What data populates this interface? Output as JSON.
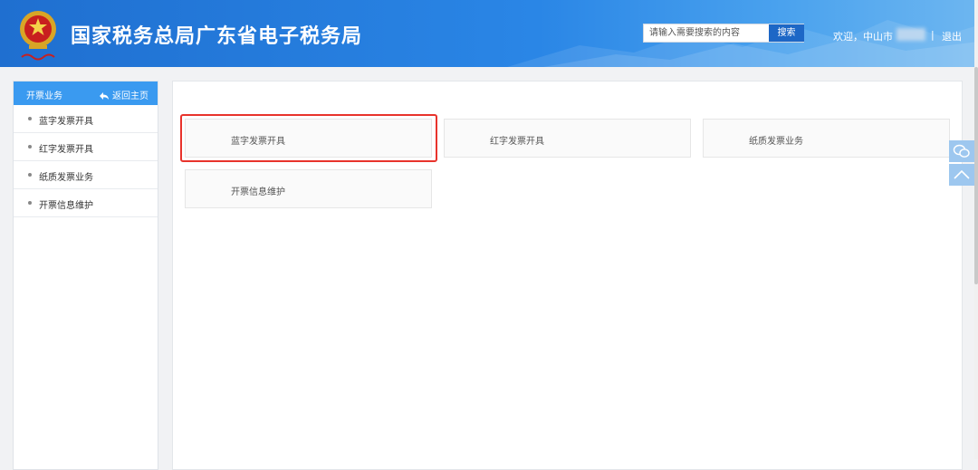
{
  "header": {
    "title": "国家税务总局广东省电子税务局",
    "search_placeholder": "请输入需要搜索的内容",
    "search_button": "搜索",
    "welcome": "欢迎，中山市",
    "separator": "|",
    "logout": "退出"
  },
  "sidebar": {
    "title": "开票业务",
    "back_label": "返回主页",
    "items": [
      {
        "label": "蓝字发票开具"
      },
      {
        "label": "红字发票开具"
      },
      {
        "label": "纸质发票业务"
      },
      {
        "label": "开票信息维护"
      }
    ]
  },
  "main": {
    "cards": [
      {
        "label": "蓝字发票开具"
      },
      {
        "label": "红字发票开具"
      },
      {
        "label": "纸质发票业务"
      },
      {
        "label": "开票信息维护"
      }
    ]
  },
  "colors": {
    "header_blue": "#2a86e6",
    "sidebar_head": "#3a9af0",
    "highlight_red": "#e8332c",
    "search_button": "#1d67c6"
  },
  "icons": {
    "emblem": "national-emblem-icon",
    "back": "back-arrow-icon",
    "wechat": "wechat-icon",
    "top": "back-to-top-icon"
  }
}
